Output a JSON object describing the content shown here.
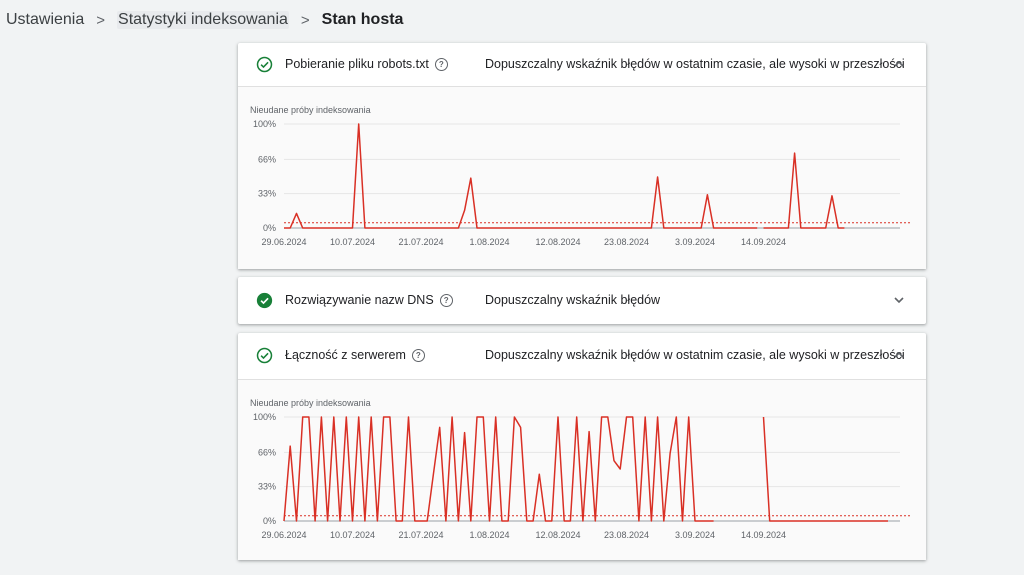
{
  "breadcrumb": {
    "items": [
      "Ustawienia",
      "Statystyki indeksowania",
      "Stan hosta"
    ]
  },
  "colors": {
    "ok_green": "#188038",
    "series_red": "#d93025",
    "grid": "#e6e6e6"
  },
  "cards": [
    {
      "title": "Pobieranie pliku robots.txt",
      "status_icon": "check-circle-outline-icon",
      "description": "Dopuszczalny wskaźnik błędów w ostatnim czasie, ale wysoki w przeszłości",
      "expanded": true
    },
    {
      "title": "Rozwiązywanie nazw DNS",
      "status_icon": "check-circle-filled-icon",
      "description": "Dopuszczalny wskaźnik błędów",
      "expanded": false
    },
    {
      "title": "Łączność z serwerem",
      "status_icon": "check-circle-outline-icon",
      "description": "Dopuszczalny wskaźnik błędów w ostatnim czasie, ale wysoki w przeszłości",
      "expanded": true
    }
  ],
  "chart_data": [
    {
      "type": "line",
      "ylabel": "Nieudane próby indeksowania",
      "y_ticks": [
        "100%",
        "66%",
        "33%",
        "0%"
      ],
      "y_tick_values": [
        100,
        66,
        33,
        0
      ],
      "ylim": [
        0,
        100
      ],
      "x_tick_labels": [
        "29.06.2024",
        "10.07.2024",
        "21.07.2024",
        "1.08.2024",
        "12.08.2024",
        "23.08.2024",
        "3.09.2024",
        "14.09.2024"
      ],
      "x_tick_index": [
        0,
        11,
        22,
        33,
        44,
        55,
        66,
        77
      ],
      "threshold": 5,
      "segments": [
        [
          0,
          0,
          14,
          0,
          0,
          0,
          0,
          0,
          0,
          0,
          0,
          0,
          100,
          0,
          0,
          0,
          0,
          0,
          0,
          0,
          0,
          0,
          0,
          0,
          0,
          0,
          0,
          0,
          0,
          17,
          48,
          0,
          0,
          0,
          0,
          0,
          0,
          0,
          0,
          0,
          0,
          0,
          0,
          0,
          0,
          0,
          0,
          0,
          0,
          0,
          0,
          0,
          0,
          0,
          0,
          0,
          0,
          0,
          0,
          0,
          49,
          0,
          0,
          0,
          0,
          0,
          0,
          0,
          32,
          0,
          0,
          0,
          0,
          0,
          0,
          0,
          0
        ],
        [
          0,
          0,
          0,
          0,
          0,
          72,
          0,
          0,
          0,
          0,
          0,
          31,
          0,
          0
        ]
      ],
      "segment_start": [
        0,
        77
      ]
    },
    {
      "type": "line",
      "ylabel": "Nieudane próby indeksowania",
      "y_ticks": [
        "100%",
        "66%",
        "33%",
        "0%"
      ],
      "y_tick_values": [
        100,
        66,
        33,
        0
      ],
      "ylim": [
        0,
        100
      ],
      "x_tick_labels": [
        "29.06.2024",
        "10.07.2024",
        "21.07.2024",
        "1.08.2024",
        "12.08.2024",
        "23.08.2024",
        "3.09.2024",
        "14.09.2024"
      ],
      "x_tick_index": [
        0,
        11,
        22,
        33,
        44,
        55,
        66,
        77
      ],
      "threshold": 5,
      "segments": [
        [
          0,
          72,
          0,
          100,
          100,
          0,
          100,
          0,
          100,
          0,
          100,
          0,
          100,
          0,
          100,
          0,
          100,
          100,
          0,
          0,
          100,
          0,
          0,
          0,
          45,
          90,
          0,
          100,
          0,
          85,
          0,
          100,
          100,
          0,
          100,
          0,
          0,
          100,
          90,
          0,
          0,
          45,
          0,
          0,
          100,
          0,
          0,
          100,
          0,
          86,
          0,
          100,
          100,
          58,
          50,
          100,
          100,
          0,
          100,
          0,
          100,
          0,
          65,
          100,
          0,
          100,
          0,
          0,
          0,
          0
        ],
        [
          100,
          0,
          0,
          0,
          0,
          0,
          0,
          0,
          0,
          0,
          0,
          0,
          0,
          0,
          0,
          0,
          0,
          0,
          0,
          0,
          0
        ]
      ],
      "segment_start": [
        0,
        77
      ]
    }
  ]
}
